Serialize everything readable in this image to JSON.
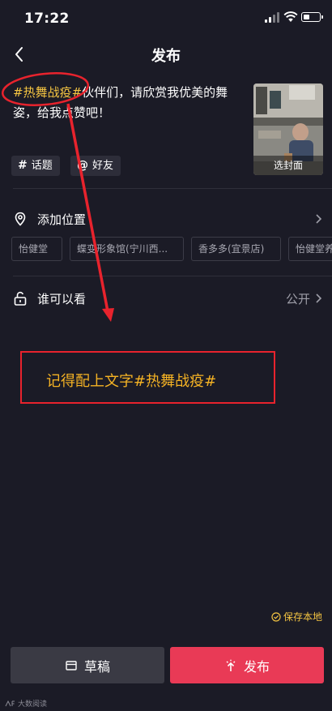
{
  "status_bar": {
    "time": "17:22",
    "battery_level": 0.3
  },
  "nav": {
    "title": "发布"
  },
  "caption": {
    "tag": "#热舞战疫#",
    "text": "伙伴们，请欣赏我优美的舞姿，给我点赞吧！"
  },
  "cover": {
    "label": "选封面"
  },
  "chips": {
    "topic": {
      "symbol": "#",
      "label": "话题"
    },
    "friend": {
      "symbol": "@",
      "label": "好友"
    }
  },
  "location": {
    "label": "添加位置",
    "suggestions": [
      "怡健堂",
      "蝶变形象馆(宁川西...",
      "香多多(宜景店)",
      "怡健堂养"
    ]
  },
  "visibility": {
    "label": "谁可以看",
    "value": "公开"
  },
  "annotation": {
    "text": "记得配上文字#热舞战疫#",
    "color": "#e8232d"
  },
  "save_local": {
    "label": "保存本地"
  },
  "actions": {
    "draft_label": "草稿",
    "publish_label": "发布"
  },
  "watermark": {
    "text": "大数阅读"
  },
  "colors": {
    "background": "#1b1b26",
    "accent": "#e93a56",
    "tag": "#f5c542"
  }
}
